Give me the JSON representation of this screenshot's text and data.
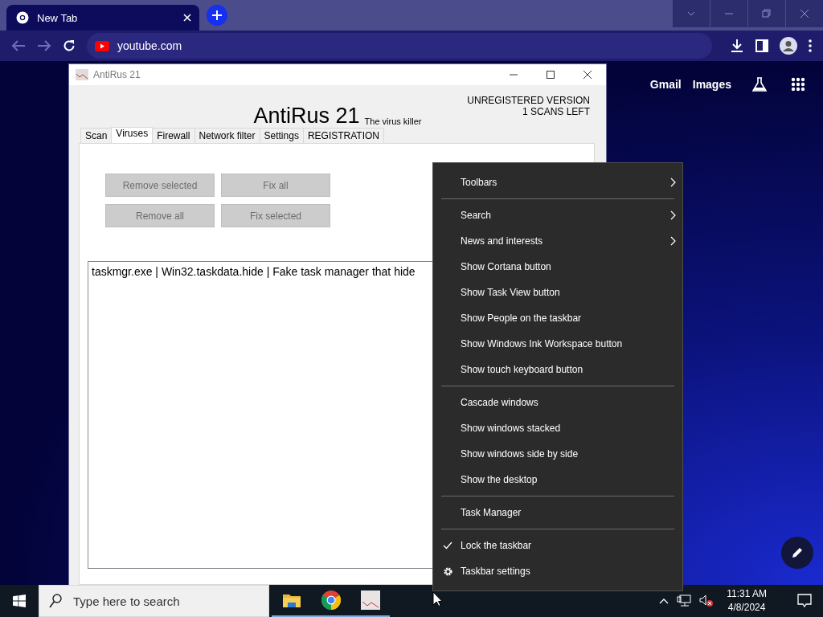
{
  "browser": {
    "tab_title": "New Tab",
    "address": "youtube.com",
    "links": [
      "Gmail",
      "Images"
    ]
  },
  "app_window": {
    "title": "AntiRus 21",
    "heading": "AntiRus 21",
    "tagline": "The virus killer",
    "status_lines": [
      "UNREGISTERED VERSION",
      "1 SCANS LEFT"
    ],
    "tabs": [
      {
        "label": "Scan",
        "selected": false
      },
      {
        "label": "Viruses",
        "selected": true
      },
      {
        "label": "Firewall",
        "selected": false
      },
      {
        "label": "Network filter",
        "selected": false
      },
      {
        "label": "Settings",
        "selected": false
      },
      {
        "label": "REGISTRATION",
        "selected": false
      }
    ],
    "buttons": [
      {
        "label": "Remove selected",
        "disabled": true
      },
      {
        "label": "Fix all",
        "disabled": true
      },
      {
        "label": "Remove all",
        "disabled": true
      },
      {
        "label": "Fix selected",
        "disabled": true
      }
    ],
    "virus_list": [
      "taskmgr.exe | Win32.taskdata.hide | Fake task manager that hide"
    ]
  },
  "context_menu": {
    "groups": [
      [
        {
          "label": "Toolbars",
          "kind": "submenu"
        }
      ],
      [
        {
          "label": "Search",
          "kind": "submenu"
        },
        {
          "label": "News and interests",
          "kind": "submenu"
        },
        {
          "label": "Show Cortana button",
          "kind": "plain"
        },
        {
          "label": "Show Task View button",
          "kind": "plain"
        },
        {
          "label": "Show People on the taskbar",
          "kind": "plain"
        },
        {
          "label": "Show Windows Ink Workspace button",
          "kind": "plain"
        },
        {
          "label": "Show touch keyboard button",
          "kind": "plain"
        }
      ],
      [
        {
          "label": "Cascade windows",
          "kind": "plain"
        },
        {
          "label": "Show windows stacked",
          "kind": "plain"
        },
        {
          "label": "Show windows side by side",
          "kind": "plain"
        },
        {
          "label": "Show the desktop",
          "kind": "plain"
        }
      ],
      [
        {
          "label": "Task Manager",
          "kind": "plain"
        }
      ],
      [
        {
          "label": "Lock the taskbar",
          "kind": "check",
          "checked": true
        },
        {
          "label": "Taskbar settings",
          "kind": "settings"
        }
      ]
    ]
  },
  "taskbar": {
    "search_placeholder": "Type here to search",
    "time": "11:31 AM",
    "date": "4/8/2024"
  }
}
